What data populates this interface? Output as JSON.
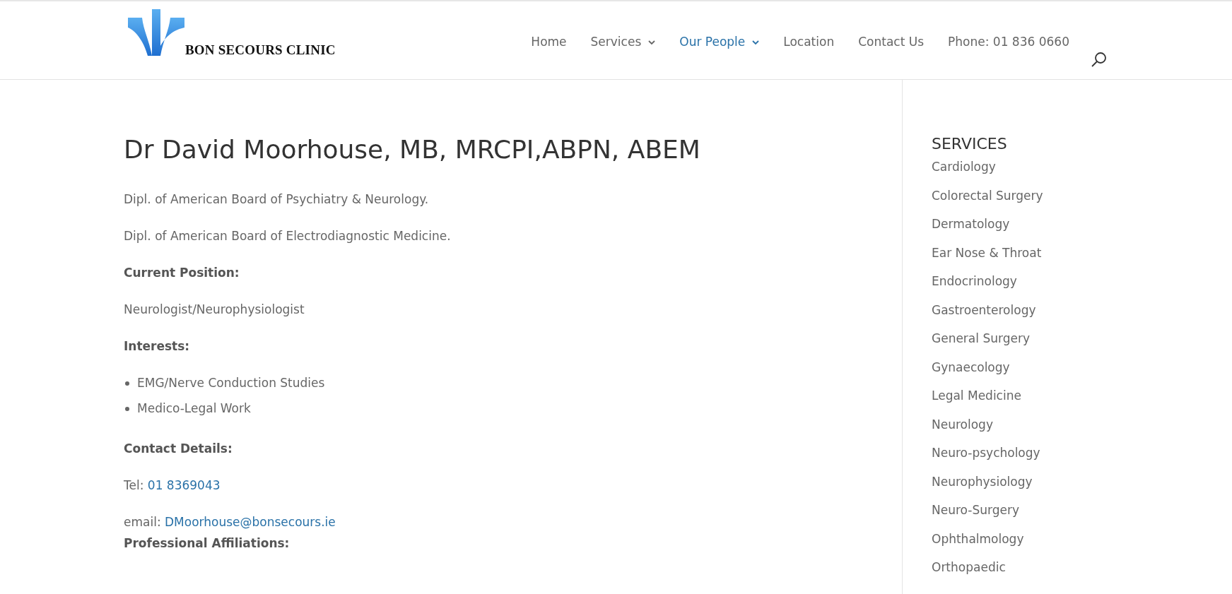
{
  "logo": {
    "text": "BON SECOURS CLINIC"
  },
  "nav": [
    {
      "label": "Home",
      "selected": false,
      "dropdown": false
    },
    {
      "label": "Services",
      "selected": false,
      "dropdown": true
    },
    {
      "label": "Our People",
      "selected": true,
      "dropdown": true
    },
    {
      "label": "Location",
      "selected": false,
      "dropdown": false
    },
    {
      "label": "Contact Us",
      "selected": false,
      "dropdown": false
    },
    {
      "label": "Phone: 01 836 0660",
      "selected": false,
      "dropdown": false
    }
  ],
  "content": {
    "title": "Dr David Moorhouse, MB, MRCPI,ABPN, ABEM",
    "blocks": [
      {
        "kind": "text",
        "text": "Dipl. of American Board of Psychiatry & Neurology."
      },
      {
        "kind": "text",
        "text": "Dipl. of American Board of Electrodiagnostic Medicine."
      },
      {
        "kind": "heading",
        "text": "Current Position:"
      },
      {
        "kind": "text",
        "text": "Neurologist/Neurophysiologist"
      },
      {
        "kind": "heading",
        "text": "Interests:"
      },
      {
        "kind": "list",
        "items": [
          "EMG/Nerve Conduction Studies",
          "Medico-Legal Work"
        ]
      },
      {
        "kind": "heading",
        "text": "Contact Details:"
      },
      {
        "kind": "link",
        "label": "Tel:",
        "link": "01 8369043"
      },
      {
        "kind": "link",
        "label": "email:",
        "link": "DMoorhouse@bonsecours.ie"
      },
      {
        "kind": "heading",
        "text": "Professional Affiliations:",
        "tight": true
      }
    ]
  },
  "sidebar": {
    "title": "SERVICES",
    "items": [
      "Cardiology",
      "Colorectal Surgery",
      "Dermatology",
      "Ear Nose & Throat",
      "Endocrinology",
      "Gastroenterology",
      "General Surgery",
      "Gynaecology",
      "Legal Medicine",
      "Neurology",
      "Neuro-psychology",
      "Neurophysiology",
      "Neuro-Surgery",
      "Ophthalmology",
      "Orthopaedic"
    ]
  }
}
